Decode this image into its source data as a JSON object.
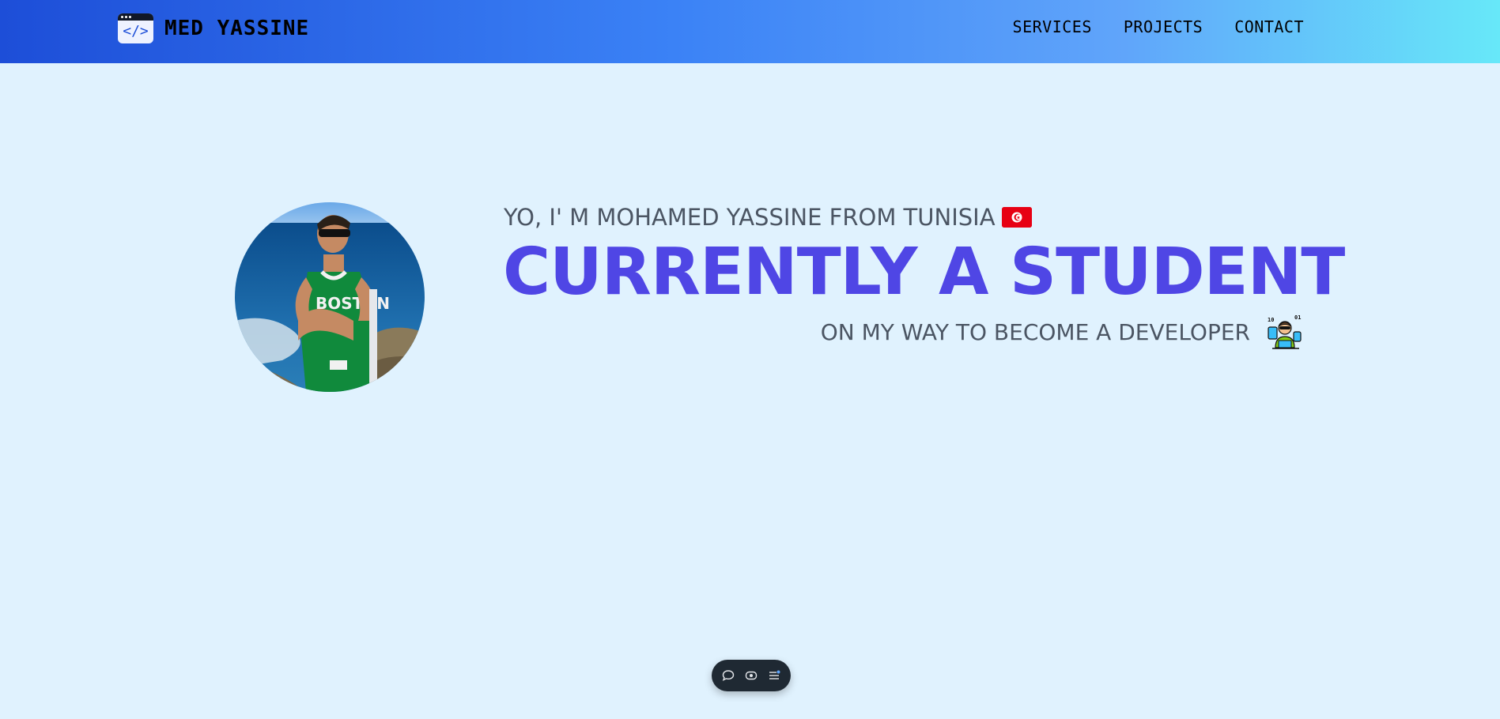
{
  "header": {
    "brand_name": "MED YASSINE",
    "logo_glyph": "</>",
    "logo_icon": "code-window-icon",
    "nav": [
      {
        "label": "SERVICES"
      },
      {
        "label": "PROJECTS"
      },
      {
        "label": "CONTACT"
      }
    ]
  },
  "hero": {
    "intro": "YO, I' M MOHAMED YASSINE FROM TUNISIA",
    "flag_icon": "tunisia-flag-icon",
    "headline": "CURRENTLY A STUDENT",
    "tagline": "ON MY WAY TO BECOME A DEVELOPER",
    "tagline_icon": "developer-icon",
    "avatar_icon": "profile-photo"
  },
  "toolbar": {
    "buttons": [
      {
        "icon": "chat-bubble-icon"
      },
      {
        "icon": "eye-icon"
      },
      {
        "icon": "list-menu-icon"
      }
    ]
  },
  "colors": {
    "background": "#e0f2fe",
    "headline": "#4f46e5",
    "header_start": "#1d4ed8",
    "header_end": "#67e8f9",
    "body_text": "#4b5563"
  }
}
